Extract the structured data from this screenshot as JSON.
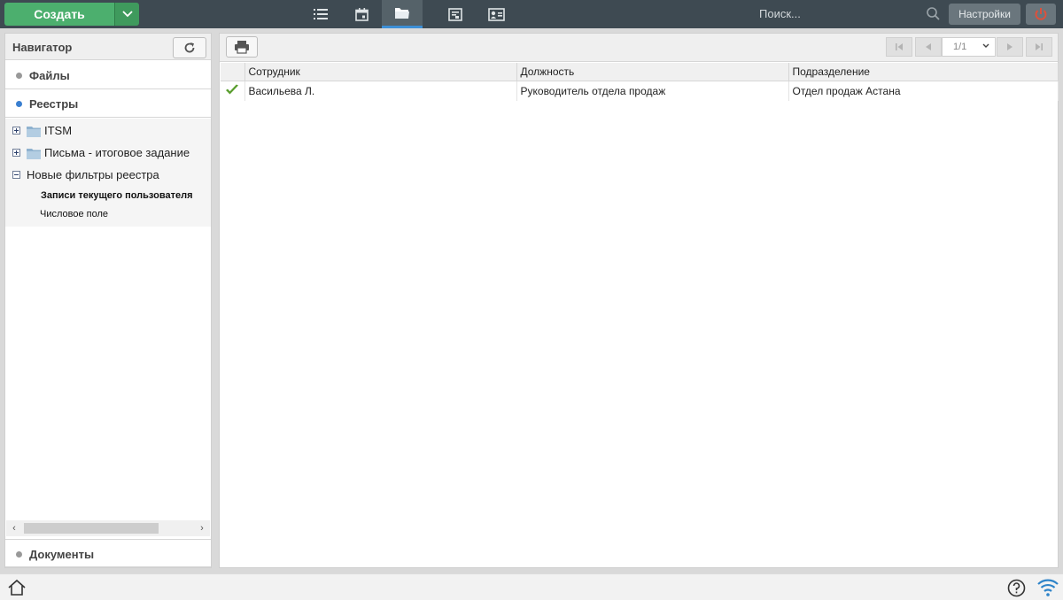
{
  "topbar": {
    "create_label": "Создать",
    "search_placeholder": "Поиск...",
    "settings_label": "Настройки",
    "nav_icons": [
      "list-icon",
      "calendar-icon",
      "folder-open-icon",
      "document-icon",
      "contact-card-icon"
    ],
    "active_nav": "folder-open-icon",
    "colors": {
      "bar": "#3e4a52",
      "create": "#4caf6e",
      "accent": "#3d8fd6",
      "power": "#e0503a"
    }
  },
  "navigator": {
    "title": "Навигатор",
    "sections": {
      "files": "Файлы",
      "registries": "Реестры",
      "documents": "Документы"
    },
    "tree": [
      {
        "label": "ITSM",
        "expanded": false
      },
      {
        "label": "Письма - итоговое задание",
        "expanded": false
      },
      {
        "label": "Новые фильтры реестра",
        "expanded": true,
        "children": [
          "Записи текущего пользователя",
          "Числовое поле"
        ]
      }
    ]
  },
  "grid": {
    "pager": "1/1",
    "columns": [
      "Сотрудник",
      "Должность",
      "Подразделение"
    ],
    "rows": [
      {
        "employee": "Васильева Л.",
        "position": "Руководитель отдела продаж",
        "department": "Отдел продаж Астана",
        "checked": true
      }
    ]
  }
}
